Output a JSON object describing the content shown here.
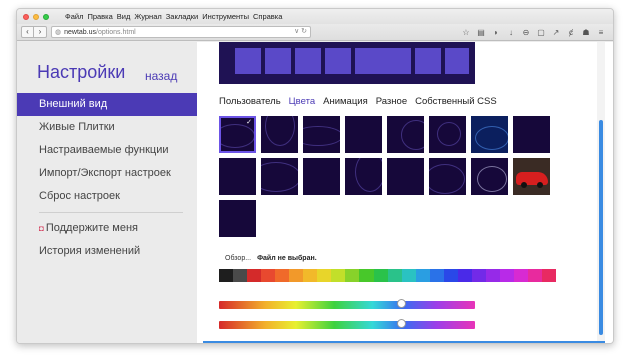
{
  "menubar": {
    "items": [
      "Файл",
      "Правка",
      "Вид",
      "Журнал",
      "Закладки",
      "Инструменты",
      "Справка"
    ]
  },
  "toolbar": {
    "back_label": "‹",
    "forward_label": "›",
    "url_host": "newtab.us",
    "url_path": "/options.html",
    "url_tools": "∨ ↻"
  },
  "sidebar": {
    "title": "Настройки",
    "back": "назад",
    "items": [
      {
        "label": "Внешний вид"
      },
      {
        "label": "Живые Плитки"
      },
      {
        "label": "Настраиваемые функции"
      },
      {
        "label": "Импорт/Экспорт настроек"
      },
      {
        "label": "Сброс настроек"
      }
    ],
    "support": "Поддержите меня",
    "history": "История изменений"
  },
  "tabs": [
    "Пользователь",
    "Цвета",
    "Анимация",
    "Разное",
    "Собственный CSS"
  ],
  "file": {
    "browse": "Обзор...",
    "status": "Файл не выбран."
  },
  "colors": {
    "accent": "#4b3ab5",
    "palette": [
      "#1e1e1e",
      "#4a4a4a",
      "#d42a2a",
      "#e8492f",
      "#f06a2a",
      "#f2992a",
      "#f2b92a",
      "#e8d52a",
      "#c2df2a",
      "#88d22a",
      "#48c82a",
      "#2ac24a",
      "#2ac28a",
      "#2ac2c2",
      "#2a9ee2",
      "#2a72e8",
      "#2a48e8",
      "#4a2ae8",
      "#722ae8",
      "#962ae8",
      "#b82ae8",
      "#d82ad2",
      "#e82a9e",
      "#e82a62"
    ]
  }
}
